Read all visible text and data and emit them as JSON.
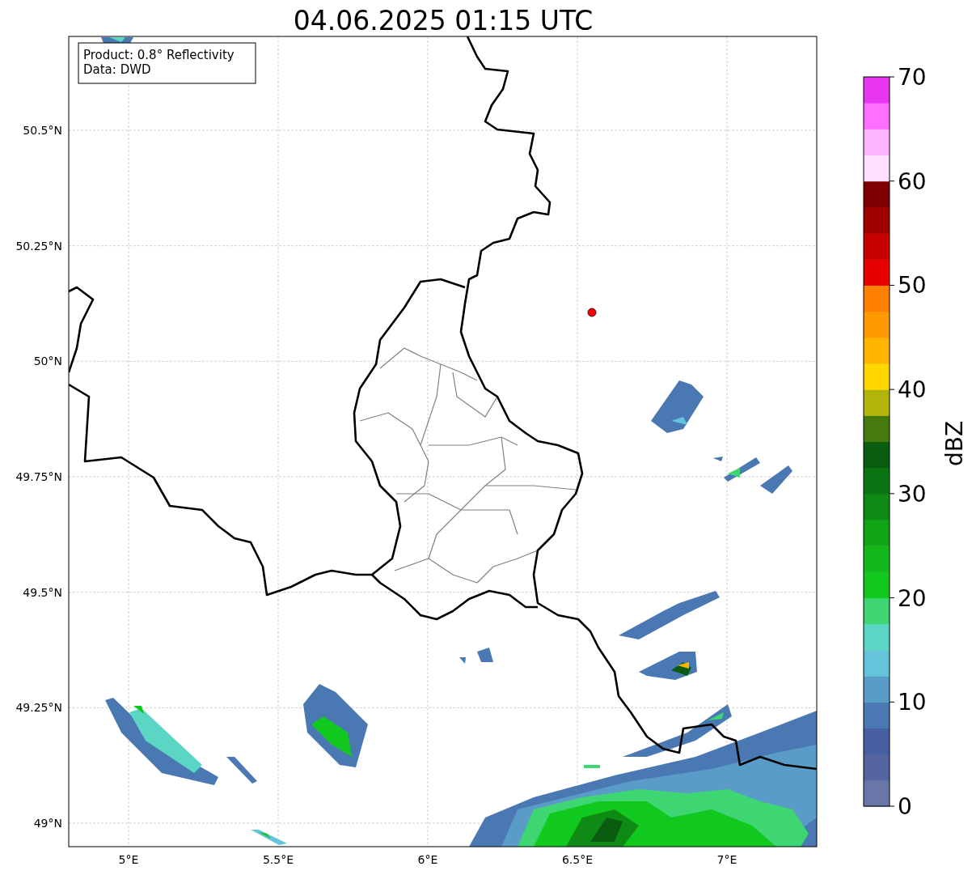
{
  "title": "04.06.2025 01:15 UTC",
  "info_box": {
    "lines": [
      "Product: 0.8° Reflectivity",
      "Data: DWD"
    ]
  },
  "map": {
    "lat_labels": [
      "50.5°N",
      "50.25°N",
      "50°N",
      "49.75°N",
      "49.5°N",
      "49.25°N",
      "49°N"
    ],
    "lon_labels": [
      "5°E",
      "5.5°E",
      "6°E",
      "6.5°E",
      "7°E"
    ]
  },
  "colorbar": {
    "label": "dBZ",
    "tick_labels": [
      "70",
      "60",
      "50",
      "40",
      "30",
      "20",
      "10",
      "0"
    ],
    "bins": [
      {
        "color": "#6877a8"
      },
      {
        "color": "#5565a0"
      },
      {
        "color": "#4660a3"
      },
      {
        "color": "#4a78b2"
      },
      {
        "color": "#5a9cc8"
      },
      {
        "color": "#66c3dc"
      },
      {
        "color": "#5cd6c4"
      },
      {
        "color": "#3dd672"
      },
      {
        "color": "#10c81e"
      },
      {
        "color": "#14b81a"
      },
      {
        "color": "#11a515"
      },
      {
        "color": "#0f8a14"
      },
      {
        "color": "#0b7514"
      },
      {
        "color": "#0a5d10"
      },
      {
        "color": "#477a0e"
      },
      {
        "color": "#b2b40a"
      },
      {
        "color": "#ffd700"
      },
      {
        "color": "#ffb400"
      },
      {
        "color": "#ff9900"
      },
      {
        "color": "#ff7f00"
      },
      {
        "color": "#e60000"
      },
      {
        "color": "#c80000"
      },
      {
        "color": "#a00000"
      },
      {
        "color": "#7f0000"
      },
      {
        "color": "#ffe0ff"
      },
      {
        "color": "#ffb4ff"
      },
      {
        "color": "#ff6eff"
      },
      {
        "color": "#e936f0"
      }
    ]
  }
}
